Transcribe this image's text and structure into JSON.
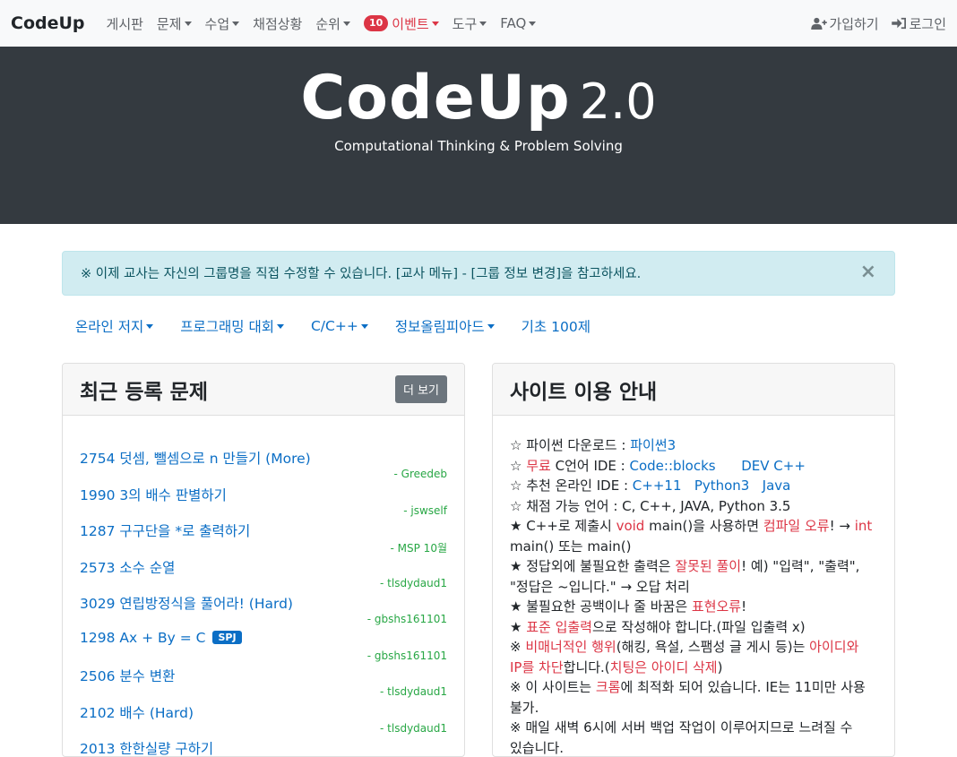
{
  "navbar": {
    "brand": "CodeUp",
    "items": [
      {
        "label": "게시판",
        "dropdown": false
      },
      {
        "label": "문제",
        "dropdown": true
      },
      {
        "label": "수업",
        "dropdown": true
      },
      {
        "label": "채점상황",
        "dropdown": false
      },
      {
        "label": "순위",
        "dropdown": true
      }
    ],
    "event": {
      "badge": "10",
      "label": "이벤트"
    },
    "items_after": [
      {
        "label": "도구",
        "dropdown": true
      },
      {
        "label": "FAQ",
        "dropdown": true
      }
    ],
    "signup": "가입하기",
    "login": "로그인",
    "icons": {
      "signup": "user-plus-icon",
      "login": "sign-in-icon"
    }
  },
  "jumbotron": {
    "title": "CodeUp",
    "version": "2.0",
    "subtitle": "Computational Thinking & Problem Solving"
  },
  "alert": {
    "text": "※ 이제 교사는 자신의 그룹명을 직접 수정할 수 있습니다. [교사 메뉴] - [그룹 정보 변경]을 참고하세요.",
    "close": "×"
  },
  "subnav": [
    {
      "label": "온라인 저지",
      "dropdown": true
    },
    {
      "label": "프로그래밍 대회",
      "dropdown": true
    },
    {
      "label": "C/C++",
      "dropdown": true
    },
    {
      "label": "정보올림피아드",
      "dropdown": true
    },
    {
      "label": "기초 100제",
      "dropdown": false
    }
  ],
  "recent": {
    "title": "최근 등록 문제",
    "more": "더 보기",
    "problems": [
      {
        "title": "2754 덧셈, 뺄셈으로 n 만들기 (More)",
        "author": "- Greedeb"
      },
      {
        "title": "1990 3의 배수 판별하기",
        "author": "- jswself"
      },
      {
        "title": "1287 구구단을 *로 출력하기",
        "author": "- MSP 10월"
      },
      {
        "title": "2573 소수 순열",
        "author": "- tlsdydaud1"
      },
      {
        "title": "3029 연립방정식을 풀어라! (Hard)",
        "author": "- gbshs161101"
      },
      {
        "title": "1298 Ax + By = C",
        "author": "- gbshs161101",
        "badge": "SPJ"
      },
      {
        "title": "2506 분수 변환",
        "author": "- tlsdydaud1"
      },
      {
        "title": "2102 배수 (Hard)",
        "author": "- tlsdydaud1"
      },
      {
        "title": "2013 한한실량 구하기",
        "author": ""
      }
    ]
  },
  "guide": {
    "title": "사이트 이용 안내",
    "l1": {
      "t1": "☆ 파이썬 다운로드 : ",
      "link": "파이썬3"
    },
    "l2": {
      "t1": "☆ ",
      "free": "무료",
      "t2": " C언어 IDE : ",
      "link1": "Code::blocks",
      "link2": "DEV C++"
    },
    "l3": {
      "t1": "☆ 추천 온라인 IDE : ",
      "link1": "C++11",
      "link2": "Python3",
      "link3": "Java"
    },
    "l4": {
      "t1": "☆ 채점 가능 언어 : C, C++, JAVA, Python 3.5"
    },
    "l5": {
      "t1": "★ C++로 제출시 ",
      "r1": "void",
      "t2": " main()을 사용하면 ",
      "r2": "컴파일 오류",
      "t3": "! → ",
      "r3": "int",
      "t4": "main() 또는 main()"
    },
    "l6": {
      "t1": "★ 정답외에 불필요한 출력은 ",
      "r1": "잘못된 풀이",
      "t2": "!  예) \"입력\", \"출력\",",
      "t3": "\"정답은 ~입니다.\" → 오답 처리"
    },
    "l7": {
      "t1": "★ 불필요한 공백이나 줄 바꿈은 ",
      "r1": "표현오류",
      "t2": "!"
    },
    "l8": {
      "t1": "★ ",
      "r1": "표준 입출력",
      "t2": "으로 작성해야 합니다.(파일 입출력 x)"
    },
    "l9": {
      "t1": "※ ",
      "r1": "비매너적인 행위",
      "t2": "(해킹, 욕설, 스팸성 글 게시 등)는 ",
      "r2": "아이디와",
      "r3": "IP를 차단",
      "t3": "합니다.(",
      "r4": "치팅은 아이디 삭제",
      "t4": ")"
    },
    "l10": {
      "t1": "※ 이 사이트는 ",
      "r1": "크롬",
      "t2": "에 최적화 되어 있습니다. IE는 11미만 사용",
      "t3": "불가."
    },
    "l11": {
      "t1": "※ 매일 새벽 6시에 서버 백업 작업이 이루어지므로 느려질 수",
      "t2": "있습니다."
    }
  }
}
